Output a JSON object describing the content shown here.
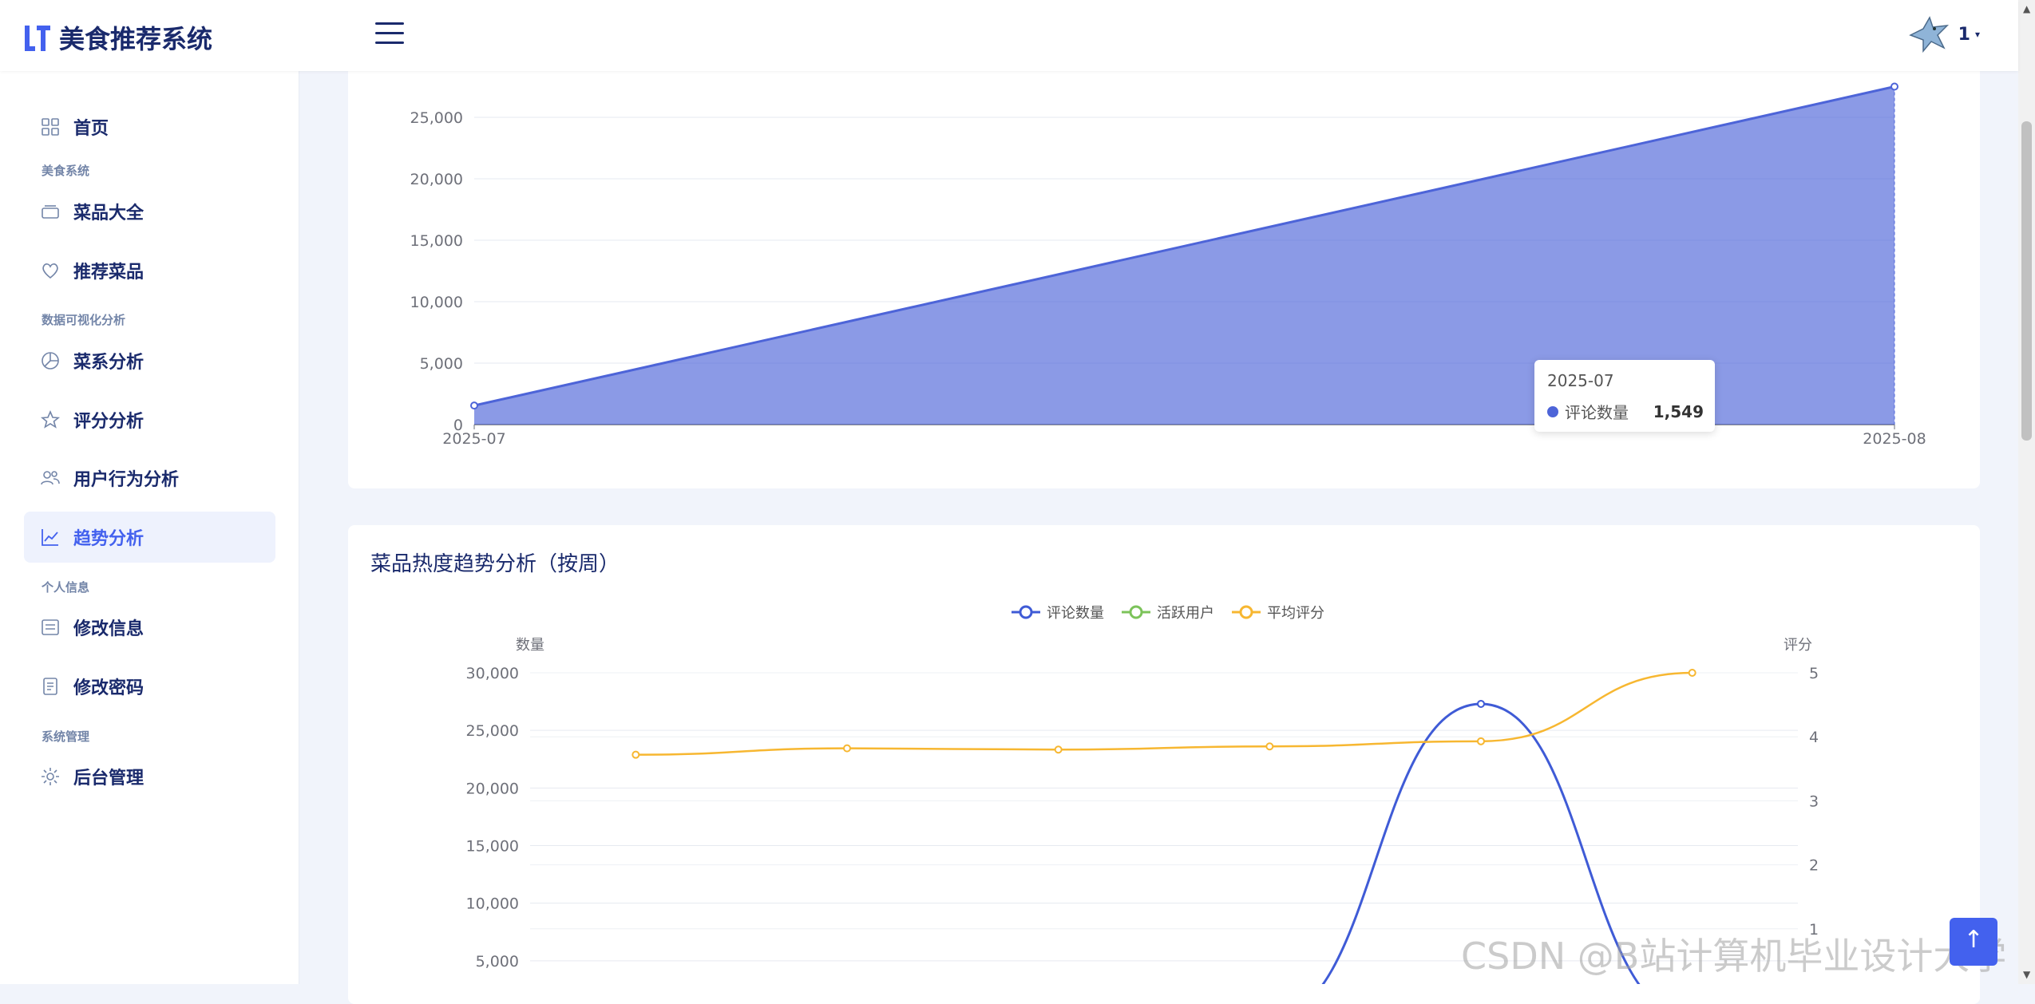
{
  "app": {
    "title": "美食推荐系统"
  },
  "user": {
    "name": "1"
  },
  "sidebar": {
    "items": [
      {
        "label": "首页"
      },
      {
        "group": "美食系统"
      },
      {
        "label": "菜品大全"
      },
      {
        "label": "推荐菜品"
      },
      {
        "group": "数据可视化分析"
      },
      {
        "label": "菜系分析"
      },
      {
        "label": "评分分析"
      },
      {
        "label": "用户行为分析"
      },
      {
        "label": "趋势分析",
        "active": true
      },
      {
        "group": "个人信息"
      },
      {
        "label": "修改信息"
      },
      {
        "label": "修改密码"
      },
      {
        "group": "系统管理"
      },
      {
        "label": "后台管理"
      }
    ]
  },
  "chart_data": [
    {
      "type": "area",
      "x": [
        "2025-07",
        "2025-08"
      ],
      "series": [
        {
          "name": "评论数量",
          "values": [
            1549,
            27500
          ],
          "color": "#4d64d8"
        }
      ],
      "ylim": [
        0,
        25000
      ],
      "yticks": [
        "0",
        "5,000",
        "10,000",
        "15,000",
        "20,000",
        "25,000"
      ],
      "grid": true,
      "tooltip": {
        "x": "2025-07",
        "series": "评论数量",
        "value": "1,549"
      }
    },
    {
      "type": "line",
      "title": "菜品热度趋势分析（按周）",
      "legend": [
        "评论数量",
        "活跃用户",
        "平均评分"
      ],
      "legend_colors": [
        "#3f5bd6",
        "#7cc35a",
        "#f7b731"
      ],
      "ylabel_left": "数量",
      "ylabel_right": "评分",
      "yticks_left": [
        "5,000",
        "10,000",
        "15,000",
        "20,000",
        "25,000",
        "30,000"
      ],
      "yticks_right": [
        "1",
        "2",
        "3",
        "4",
        "5"
      ],
      "ylim_left": [
        0,
        30000
      ],
      "ylim_right": [
        0,
        5
      ],
      "series": [
        {
          "name": "评论数量",
          "axis": "left",
          "values": [
            0,
            0,
            0,
            0,
            27300,
            0
          ]
        },
        {
          "name": "平均评分",
          "axis": "right",
          "values": [
            3.72,
            3.82,
            3.8,
            3.85,
            3.93,
            5.0
          ]
        }
      ]
    }
  ],
  "watermark": "CSDN @B站计算机毕业设计大学",
  "scroll_top_icon": "arrow-up-icon"
}
